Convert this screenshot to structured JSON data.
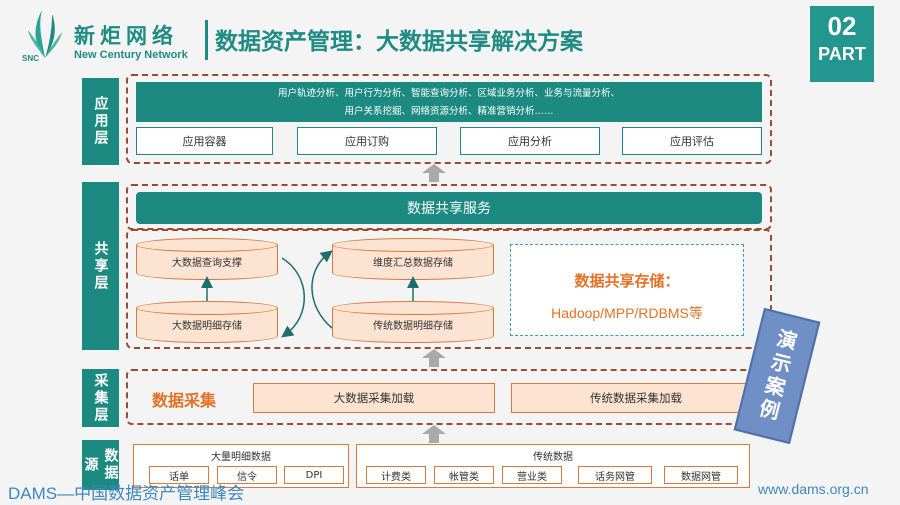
{
  "header": {
    "logo_cn": "新炬网络",
    "logo_snc": "SNC",
    "logo_en": "New Century Network",
    "title": "数据资产管理：大数据共享解决方案",
    "part_number": "02",
    "part_label": "PART"
  },
  "layers": {
    "app": {
      "label": "应用层",
      "analysis_line1": "用户轨迹分析、用户行为分析、智能查询分析、区域业务分析、业务与流量分析、",
      "analysis_line2": "用户关系挖掘、网络资源分析、精准营销分析……",
      "buttons": [
        "应用容器",
        "应用订购",
        "应用分析",
        "应用评估"
      ]
    },
    "share": {
      "label": "共享层",
      "service": "数据共享服务",
      "cylinders": [
        "大数据查询支撑",
        "维度汇总数据存储",
        "大数据明细存储",
        "传统数据明细存储"
      ],
      "store_title": "数据共享存储：",
      "store_sub": "Hadoop/MPP/RDBMS等"
    },
    "collect": {
      "label": "采集层",
      "title": "数据采集",
      "buttons": [
        "大数据采集加载",
        "传统数据采集加载"
      ]
    },
    "source": {
      "label": "数据源",
      "group1_title": "大量明细数据",
      "group1_items": [
        "话单",
        "信令",
        "DPI"
      ],
      "group2_title": "传统数据",
      "group2_items": [
        "计费类",
        "帐管类",
        "营业类",
        "话务网管",
        "数据网管"
      ]
    }
  },
  "badge": "演示案例",
  "footer": {
    "left": "DAMS—中国数据资产管理峰会",
    "right": "www.dams.org.cn"
  },
  "colors": {
    "teal": "#1c8a80",
    "orange": "#e27228",
    "dash_border": "#9e4a2e",
    "peach": "#fde4d2"
  }
}
